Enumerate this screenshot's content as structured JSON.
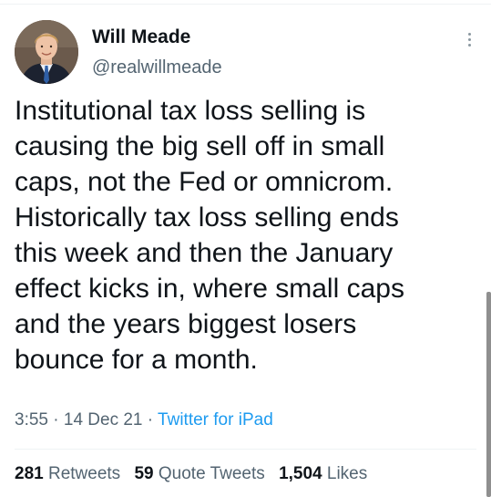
{
  "author": {
    "name": "Will Meade",
    "handle": "@realwillmeade",
    "avatar_icon": "profile-photo"
  },
  "tweet": {
    "lines": [
      "Institutional tax loss selling is",
      "causing the big sell off in small",
      "caps, not the Fed or omnicrom.",
      "Historically tax loss selling ends",
      "this week and then the January",
      "effect kicks in, where small caps",
      "and the years biggest losers",
      "bounce for a month."
    ],
    "time": "3:55",
    "separator": " · ",
    "date": "14 Dec 21",
    "source": "Twitter for iPad"
  },
  "stats": {
    "retweets_count": "281",
    "retweets_label": "Retweets",
    "quote_count": "59",
    "quote_label": "Quote Tweets",
    "likes_count": "1,504",
    "likes_label": "Likes"
  },
  "colors": {
    "text": "#0f1419",
    "secondary": "#536471",
    "link": "#1d9bf0",
    "divider": "#eff3f4"
  }
}
